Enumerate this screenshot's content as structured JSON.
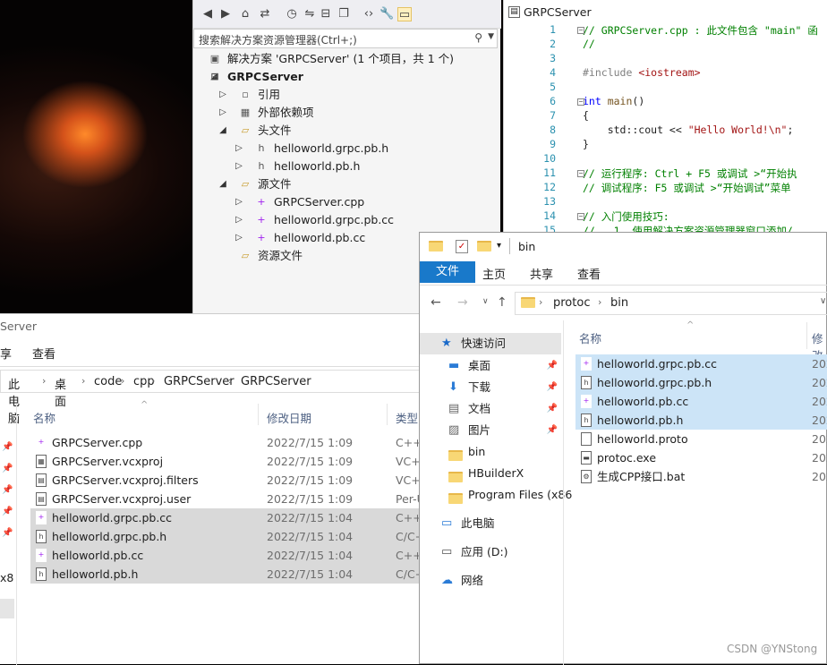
{
  "vs": {
    "search_placeholder": "搜索解决方案资源管理器(Ctrl+;)",
    "tree": [
      {
        "label": "解决方案 'GRPCServer' (1 个项目，共 1 个)",
        "icon": "solution-icon",
        "depth": 0
      },
      {
        "label": "GRPCServer",
        "icon": "project-icon",
        "depth": 0
      },
      {
        "label": "引用",
        "icon": "references-icon",
        "depth": 1
      },
      {
        "label": "外部依赖项",
        "icon": "external-deps-icon",
        "depth": 1
      },
      {
        "label": "头文件",
        "icon": "filter-folder-icon",
        "depth": 1
      },
      {
        "label": "helloworld.grpc.pb.h",
        "icon": "header-file-icon",
        "depth": 2
      },
      {
        "label": "helloworld.pb.h",
        "icon": "header-file-icon",
        "depth": 2
      },
      {
        "label": "源文件",
        "icon": "filter-folder-icon",
        "depth": 1
      },
      {
        "label": "GRPCServer.cpp",
        "icon": "cpp-file-icon",
        "depth": 2
      },
      {
        "label": "helloworld.grpc.pb.cc",
        "icon": "cpp-file-icon",
        "depth": 2
      },
      {
        "label": "helloworld.pb.cc",
        "icon": "cpp-file-icon",
        "depth": 2
      },
      {
        "label": "资源文件",
        "icon": "filter-folder-icon",
        "depth": 1
      }
    ]
  },
  "editor": {
    "tab_title": "GRPCServer",
    "lines": [
      {
        "n": "1",
        "t": "// GRPCServer.cpp : 此文件包含 \"main\" 函"
      },
      {
        "n": "2",
        "t": "//"
      },
      {
        "n": "3",
        "t": ""
      },
      {
        "n": "4",
        "t": "#include <iostream>"
      },
      {
        "n": "5",
        "t": ""
      },
      {
        "n": "6",
        "t": "int main()"
      },
      {
        "n": "7",
        "t": "{"
      },
      {
        "n": "8",
        "t": "    std::cout << \"Hello World!\\n\";"
      },
      {
        "n": "9",
        "t": "}"
      },
      {
        "n": "10",
        "t": ""
      },
      {
        "n": "11",
        "t": "// 运行程序: Ctrl + F5 或调试 >“开始执"
      },
      {
        "n": "12",
        "t": "// 调试程序: F5 或调试 >“开始调试”菜单"
      },
      {
        "n": "13",
        "t": ""
      },
      {
        "n": "14",
        "t": "// 入门使用技巧:"
      },
      {
        "n": "15",
        "t": "//   1. 使用解决方案资源管理器窗口添加/"
      }
    ]
  },
  "explorer_left": {
    "title": "Server",
    "ribbon_tabs": [
      "享",
      "查看"
    ],
    "breadcrumb": [
      "此电脑",
      "桌面",
      "code",
      "cpp",
      "GRPCServer",
      "GRPCServer"
    ],
    "columns": [
      "名称",
      "修改日期",
      "类型"
    ],
    "nav_partial": "x8",
    "files": [
      {
        "name": "GRPCServer.cpp",
        "date": "2022/7/15 1:09",
        "type": "C++",
        "icon": "cpp-file-icon",
        "selected": false
      },
      {
        "name": "GRPCServer.vcxproj",
        "date": "2022/7/15 1:09",
        "type": "VC+",
        "icon": "vcxproj-file-icon",
        "selected": false
      },
      {
        "name": "GRPCServer.vcxproj.filters",
        "date": "2022/7/15 1:09",
        "type": "VC+",
        "icon": "filters-file-icon",
        "selected": false
      },
      {
        "name": "GRPCServer.vcxproj.user",
        "date": "2022/7/15 1:09",
        "type": "Per-U",
        "icon": "user-file-icon",
        "selected": false
      },
      {
        "name": "helloworld.grpc.pb.cc",
        "date": "2022/7/15 1:04",
        "type": "C++",
        "icon": "cpp-file-icon",
        "selected": true
      },
      {
        "name": "helloworld.grpc.pb.h",
        "date": "2022/7/15 1:04",
        "type": "C/C+",
        "icon": "header-file-icon",
        "selected": true
      },
      {
        "name": "helloworld.pb.cc",
        "date": "2022/7/15 1:04",
        "type": "C++",
        "icon": "cpp-file-icon",
        "selected": true
      },
      {
        "name": "helloworld.pb.h",
        "date": "2022/7/15 1:04",
        "type": "C/C+",
        "icon": "header-file-icon",
        "selected": true
      }
    ]
  },
  "explorer_right": {
    "title": "bin",
    "ribbon_tabs": [
      "文件",
      "主页",
      "共享",
      "查看"
    ],
    "breadcrumb": [
      "protoc",
      "bin"
    ],
    "columns": [
      "名称",
      "修改"
    ],
    "nav": [
      {
        "label": "快速访问",
        "icon": "star-icon",
        "pinned": false
      },
      {
        "label": "桌面",
        "icon": "desktop-icon",
        "pinned": true
      },
      {
        "label": "下载",
        "icon": "download-icon",
        "pinned": true
      },
      {
        "label": "文档",
        "icon": "documents-icon",
        "pinned": true
      },
      {
        "label": "图片",
        "icon": "pictures-icon",
        "pinned": true
      },
      {
        "label": "bin",
        "icon": "folder-icon",
        "pinned": false
      },
      {
        "label": "HBuilderX",
        "icon": "folder-icon",
        "pinned": false
      },
      {
        "label": "Program Files (x86",
        "icon": "folder-icon",
        "pinned": false
      },
      {
        "label": "此电脑",
        "icon": "computer-icon",
        "pinned": false
      },
      {
        "label": "应用 (D:)",
        "icon": "drive-icon",
        "pinned": false
      },
      {
        "label": "网络",
        "icon": "network-icon",
        "pinned": false
      }
    ],
    "files": [
      {
        "name": "helloworld.grpc.pb.cc",
        "date": "202",
        "icon": "cpp-file-icon",
        "selected": true
      },
      {
        "name": "helloworld.grpc.pb.h",
        "date": "202",
        "icon": "header-file-icon",
        "selected": true
      },
      {
        "name": "helloworld.pb.cc",
        "date": "202",
        "icon": "cpp-file-icon",
        "selected": true
      },
      {
        "name": "helloworld.pb.h",
        "date": "202",
        "icon": "header-file-icon",
        "selected": true
      },
      {
        "name": "helloworld.proto",
        "date": "202",
        "icon": "generic-file-icon",
        "selected": false
      },
      {
        "name": "protoc.exe",
        "date": "202",
        "icon": "exe-file-icon",
        "selected": false
      },
      {
        "name": "生成CPP接口.bat",
        "date": "202",
        "icon": "bat-file-icon",
        "selected": false
      }
    ]
  },
  "watermark": "CSDN @YNStong"
}
